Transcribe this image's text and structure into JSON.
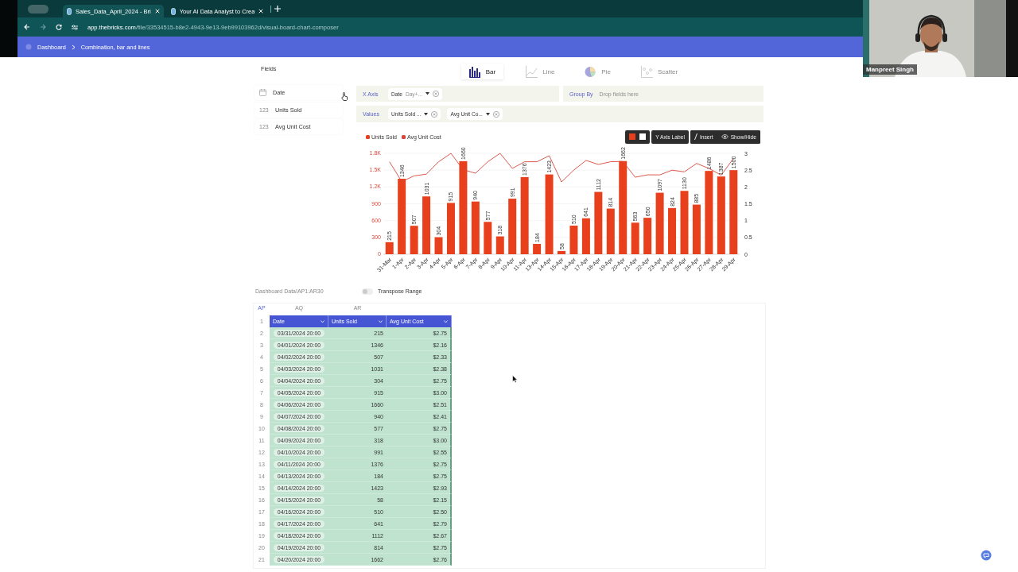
{
  "browser": {
    "tabs": [
      {
        "title": "Sales_Data_April_2024 - Bri",
        "selected": true
      },
      {
        "title": "Your AI Data Analyst to Crea",
        "selected": false
      }
    ],
    "url_domain": "app.thebricks.com",
    "url_path": "/file/33534515-b8e2-4943-9e13-9eb99103962d/visual-board-chart-composer"
  },
  "breadcrumb": [
    "Dashboard",
    "Combination, bar and lines"
  ],
  "webcam": {
    "kind": "picture",
    "name": "Manpreet Singh"
  },
  "fields": {
    "title": "Fields",
    "items": [
      {
        "kind": "date",
        "label": "Date"
      },
      {
        "kind": "number",
        "type_label": "123",
        "label": "Units Sold"
      },
      {
        "kind": "number",
        "type_label": "123",
        "label": "Avg Unit Cost"
      }
    ]
  },
  "chart_types": [
    {
      "kind": "bar",
      "label": "Bar",
      "selected": true
    },
    {
      "kind": "line",
      "label": "Line",
      "selected": false
    },
    {
      "kind": "pie",
      "label": "Pie",
      "selected": false
    },
    {
      "kind": "scatter",
      "label": "Scatter",
      "selected": false
    }
  ],
  "x_axis": {
    "label": "X Axis",
    "chips": [
      {
        "label": "Date",
        "detail": "Day+..."
      }
    ]
  },
  "group_by": {
    "label": "Group By",
    "placeholder": "Drop fields here"
  },
  "values": {
    "label": "Values",
    "chips": [
      {
        "label": "Units Sold ..."
      },
      {
        "label": "Avg Unit Co..."
      }
    ]
  },
  "toolbar": {
    "swatches": [
      {
        "color": "#e8401c"
      },
      {
        "color": "#ffffff"
      }
    ],
    "buttons": [
      {
        "kind": "label",
        "label": "Y Axis Label"
      },
      {
        "kind": "insert",
        "label": "Insert"
      },
      {
        "kind": "visibility",
        "label": "Show/Hide"
      }
    ]
  },
  "chart_data": {
    "type": "bar",
    "categories": [
      "31-Mar",
      "1-Apr",
      "2-Apr",
      "3-Apr",
      "4-Apr",
      "5-Apr",
      "6-Apr",
      "7-Apr",
      "8-Apr",
      "9-Apr",
      "10-Apr",
      "11-Apr",
      "13-Apr",
      "14-Apr",
      "15-Apr",
      "16-Apr",
      "17-Apr",
      "18-Apr",
      "19-Apr",
      "20-Apr",
      "21-Apr",
      "22-Apr",
      "23-Apr",
      "24-Apr",
      "25-Apr",
      "26-Apr",
      "27-Apr",
      "28-Apr",
      "29-Apr"
    ],
    "series": [
      {
        "name": "Units Sold",
        "type": "bar",
        "color": "#e8401c",
        "values": [
          215,
          1346,
          507,
          1031,
          304,
          915,
          1660,
          940,
          577,
          318,
          991,
          1376,
          184,
          1423,
          58,
          510,
          641,
          1112,
          814,
          1662,
          563,
          650,
          1097,
          824,
          1130,
          885,
          1486,
          1387,
          1500
        ]
      },
      {
        "name": "Avg Unit Cost",
        "type": "line",
        "axis": "y2",
        "color": "#d8463a",
        "values": [
          2.75,
          2.16,
          2.33,
          2.38,
          2.75,
          3.0,
          2.51,
          2.41,
          2.75,
          3.0,
          2.55,
          2.75,
          2.75,
          2.93,
          2.15,
          2.5,
          2.79,
          2.67,
          2.75,
          2.76,
          2.29,
          2.36,
          2.36,
          2.5,
          2.45,
          2.7,
          2.55,
          2.35,
          2.85
        ]
      }
    ],
    "ylim": [
      0,
      1800
    ],
    "yticks": [
      {
        "value": 0,
        "label": "0"
      },
      {
        "value": 300,
        "label": "300"
      },
      {
        "value": 600,
        "label": "600"
      },
      {
        "value": 900,
        "label": "900"
      },
      {
        "value": 1200,
        "label": "1.2K"
      },
      {
        "value": 1500,
        "label": "1.5K"
      },
      {
        "value": 1800,
        "label": "1.8K"
      }
    ],
    "y2lim": [
      0,
      3
    ],
    "y2ticks": [
      {
        "value": 0,
        "label": "0"
      },
      {
        "value": 0.5,
        "label": "0.5"
      },
      {
        "value": 1,
        "label": "1"
      },
      {
        "value": 1.5,
        "label": "1.5"
      },
      {
        "value": 2,
        "label": "2"
      },
      {
        "value": 2.5,
        "label": "2.5"
      },
      {
        "value": 3,
        "label": "3"
      }
    ],
    "grid": true,
    "value_labels": [
      [
        "215",
        "1346",
        "507",
        "1031",
        "304",
        "915",
        "1660",
        "940",
        "577",
        "318",
        "991",
        "1376",
        "184",
        "1423",
        "58",
        "510",
        "641",
        "1112",
        "814",
        "1662",
        "563",
        "650",
        "1097",
        "824",
        "1130",
        "885",
        "1486",
        "1387",
        "1500"
      ],
      null
    ]
  },
  "sheet": {
    "range": "Dashboard Data!AP1:AR30",
    "transpose": {
      "label": "Transpose Range",
      "on": false
    },
    "column_letters": [
      "AP",
      "AQ",
      "AR"
    ],
    "header": {
      "row": "1",
      "cells": [
        "Date",
        "Units Sold",
        "Avg Unit Cost"
      ]
    },
    "rows": [
      {
        "row": "2",
        "cells": [
          "03/31/2024 20:00",
          "215",
          "$2.75"
        ]
      },
      {
        "row": "3",
        "cells": [
          "04/01/2024 20:00",
          "1346",
          "$2.16"
        ]
      },
      {
        "row": "4",
        "cells": [
          "04/02/2024 20:00",
          "507",
          "$2.33"
        ]
      },
      {
        "row": "5",
        "cells": [
          "04/03/2024 20:00",
          "1031",
          "$2.38"
        ]
      },
      {
        "row": "6",
        "cells": [
          "04/04/2024 20:00",
          "304",
          "$2.75"
        ]
      },
      {
        "row": "7",
        "cells": [
          "04/05/2024 20:00",
          "915",
          "$3.00"
        ]
      },
      {
        "row": "8",
        "cells": [
          "04/06/2024 20:00",
          "1660",
          "$2.51"
        ]
      },
      {
        "row": "9",
        "cells": [
          "04/07/2024 20:00",
          "940",
          "$2.41"
        ]
      },
      {
        "row": "10",
        "cells": [
          "04/08/2024 20:00",
          "577",
          "$2.75"
        ]
      },
      {
        "row": "11",
        "cells": [
          "04/09/2024 20:00",
          "318",
          "$3.00"
        ]
      },
      {
        "row": "12",
        "cells": [
          "04/10/2024 20:00",
          "991",
          "$2.55"
        ]
      },
      {
        "row": "13",
        "cells": [
          "04/11/2024 20:00",
          "1376",
          "$2.75"
        ]
      },
      {
        "row": "14",
        "cells": [
          "04/13/2024 20:00",
          "184",
          "$2.75"
        ]
      },
      {
        "row": "15",
        "cells": [
          "04/14/2024 20:00",
          "1423",
          "$2.93"
        ]
      },
      {
        "row": "16",
        "cells": [
          "04/15/2024 20:00",
          "58",
          "$2.15"
        ]
      },
      {
        "row": "17",
        "cells": [
          "04/16/2024 20:00",
          "510",
          "$2.50"
        ]
      },
      {
        "row": "18",
        "cells": [
          "04/17/2024 20:00",
          "641",
          "$2.79"
        ]
      },
      {
        "row": "19",
        "cells": [
          "04/18/2024 20:00",
          "1112",
          "$2.67"
        ]
      },
      {
        "row": "20",
        "cells": [
          "04/19/2024 20:00",
          "814",
          "$2.75"
        ]
      },
      {
        "row": "21",
        "cells": [
          "04/20/2024 20:00",
          "1662",
          "$2.76"
        ]
      }
    ]
  }
}
